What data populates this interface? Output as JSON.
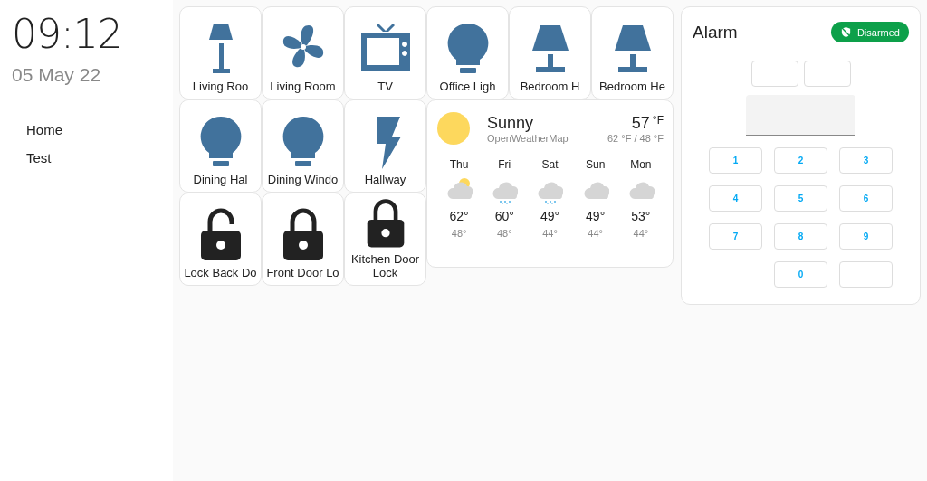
{
  "sidebar": {
    "time": "09:12",
    "date": "05 May 22",
    "items": [
      {
        "label": "Home",
        "selected": false
      },
      {
        "label": "Test",
        "selected": false
      }
    ]
  },
  "tiles": [
    {
      "label": "Living Roo",
      "kind": "floor-lamp"
    },
    {
      "label": "Living Room",
      "kind": "fan"
    },
    {
      "label": "TV",
      "kind": "tv"
    },
    {
      "label": "Office Ligh",
      "kind": "bulb"
    },
    {
      "label": "Bedroom H",
      "kind": "table-lamp"
    },
    {
      "label": "Bedroom He",
      "kind": "table-lamp"
    },
    {
      "label": "Dining Hal",
      "kind": "bulb"
    },
    {
      "label": "Dining Windo",
      "kind": "bulb"
    },
    {
      "label": "Hallway",
      "kind": "bolt"
    },
    {
      "label": "Lock Back Do",
      "kind": "lock",
      "locked": false
    },
    {
      "label": "Front Door Lo",
      "kind": "lock",
      "locked": true
    },
    {
      "label": "Kitchen Door Lock",
      "kind": "lock",
      "locked": true
    }
  ],
  "weather": {
    "condition": "Sunny",
    "source": "OpenWeatherMap",
    "temperature": "57",
    "unit": "°F",
    "high_low": "62 °F / 48 °F",
    "forecast": [
      {
        "day": "Thu",
        "kind": "partly-cloudy",
        "high": "62°",
        "low": "48°"
      },
      {
        "day": "Fri",
        "kind": "rainy",
        "high": "60°",
        "low": "48°"
      },
      {
        "day": "Sat",
        "kind": "rainy",
        "high": "49°",
        "low": "44°"
      },
      {
        "day": "Sun",
        "kind": "cloudy",
        "high": "49°",
        "low": "44°"
      },
      {
        "day": "Mon",
        "kind": "cloudy",
        "high": "53°",
        "low": "44°"
      }
    ]
  },
  "alarm": {
    "title": "Alarm",
    "status": "Disarmed",
    "armed": false,
    "keys": [
      {
        "kind": "digit",
        "label": "1"
      },
      {
        "kind": "digit",
        "label": "2"
      },
      {
        "kind": "digit",
        "label": "3"
      },
      {
        "kind": "digit",
        "label": "4"
      },
      {
        "kind": "digit",
        "label": "5"
      },
      {
        "kind": "digit",
        "label": "6"
      },
      {
        "kind": "digit",
        "label": "7"
      },
      {
        "kind": "digit",
        "label": "8"
      },
      {
        "kind": "digit",
        "label": "9"
      },
      {
        "kind": "spacer"
      },
      {
        "kind": "digit",
        "label": "0"
      },
      {
        "kind": "blank-button"
      }
    ]
  }
}
